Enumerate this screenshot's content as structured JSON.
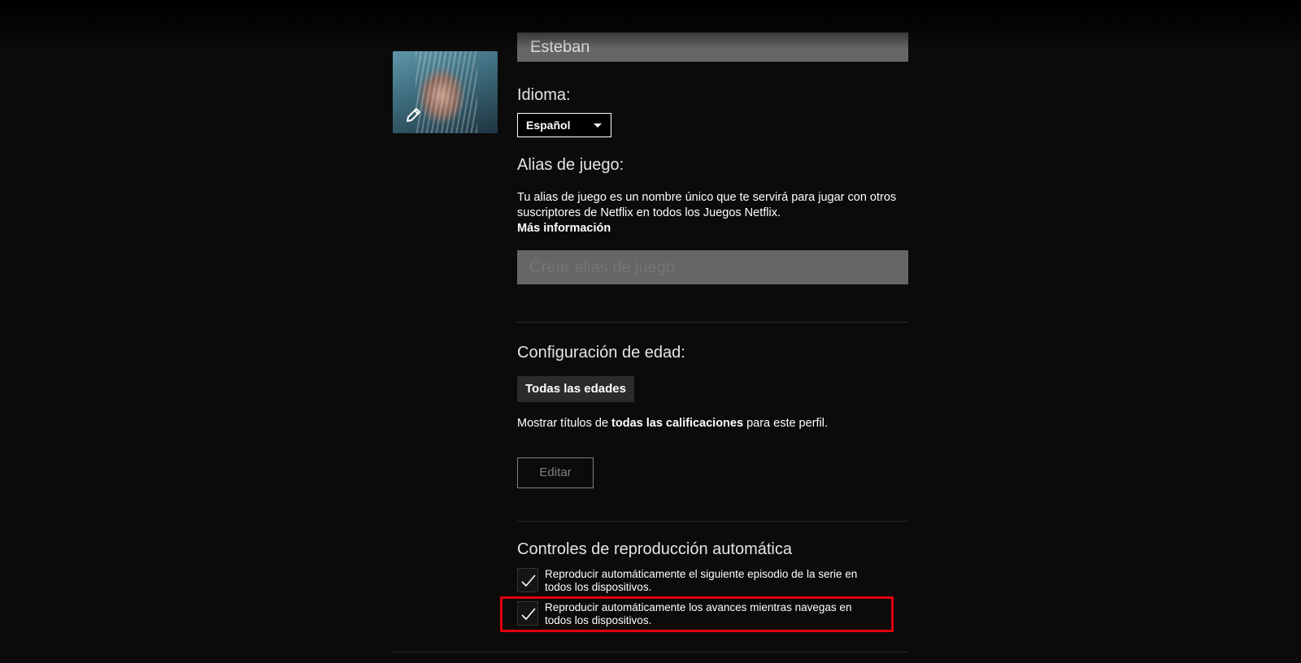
{
  "profile": {
    "name_value": "Esteban",
    "language_label": "Idioma:",
    "language_selected": "Español"
  },
  "game_alias": {
    "heading": "Alias de juego:",
    "description": "Tu alias de juego es un nombre único que te servirá para jugar con otros suscriptores de Netflix en todos los Juegos Netflix.",
    "more_info": "Más información",
    "input_placeholder": "Crear alias de juego"
  },
  "age_settings": {
    "heading": "Configuración de edad:",
    "badge": "Todas las edades",
    "desc_prefix": "Mostrar títulos de ",
    "desc_bold": "todas las calificaciones",
    "desc_suffix": " para este perfil.",
    "edit_button": "Editar"
  },
  "autoplay": {
    "heading": "Controles de reproducción automática",
    "options": [
      {
        "label": "Reproducir automáticamente el siguiente episodio de la serie en todos los dispositivos.",
        "checked": true
      },
      {
        "label": "Reproducir automáticamente los avances mientras navegas en todos los dispositivos.",
        "checked": true
      }
    ]
  },
  "icons": {
    "avatar_edit": "pencil-icon",
    "checkmark": "checkmark-icon",
    "dropdown": "caret-down-icon"
  },
  "colors": {
    "background": "#0b0b0b",
    "input_bg": "#666666",
    "highlight": "#e0000b"
  }
}
